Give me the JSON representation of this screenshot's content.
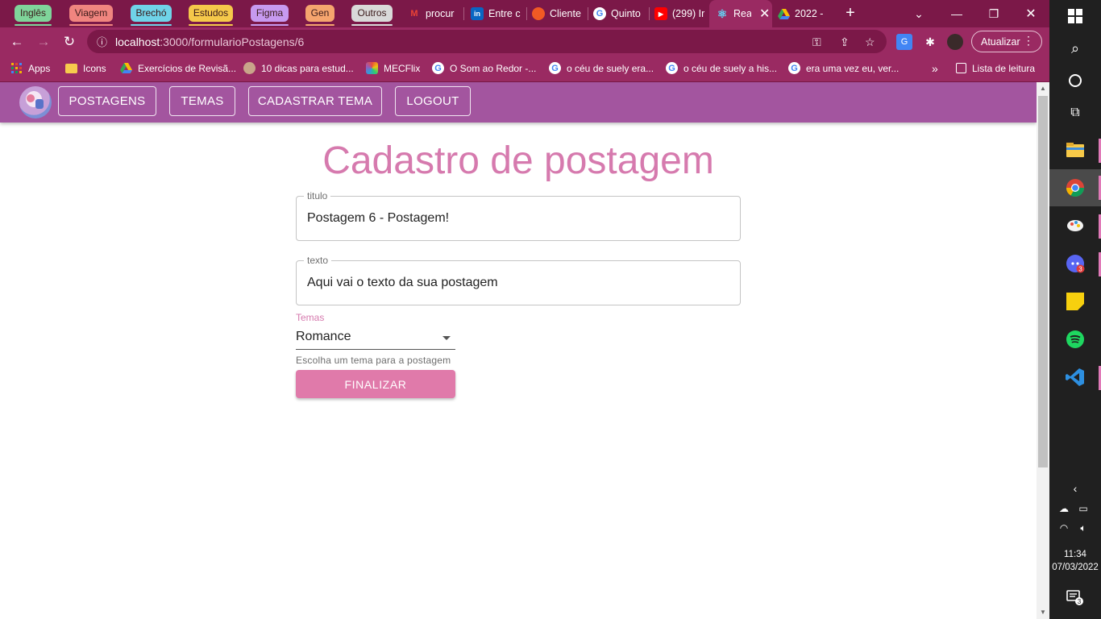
{
  "tab_groups": [
    {
      "label": "Inglês",
      "color": "#7fd49a"
    },
    {
      "label": "Viagem",
      "color": "#f0857f"
    },
    {
      "label": "Brechó",
      "color": "#6fd3e8"
    },
    {
      "label": "Estudos",
      "color": "#f5c84a"
    },
    {
      "label": "Figma",
      "color": "#c79af0"
    },
    {
      "label": "Gen",
      "color": "#f5a56e"
    },
    {
      "label": "Outros",
      "color": "#d9d9d9"
    }
  ],
  "tabs": [
    {
      "label": "procur",
      "icon": "gmail-icon"
    },
    {
      "label": "Entre c",
      "icon": "linkedin-icon"
    },
    {
      "label": "Cliente",
      "icon": "orange-app-icon"
    },
    {
      "label": "Quinto",
      "icon": "google-icon"
    },
    {
      "label": "(299) Ir",
      "icon": "youtube-icon"
    },
    {
      "label": "Rea",
      "icon": "react-icon",
      "active": true
    },
    {
      "label": "2022 -",
      "icon": "google-drive-icon"
    }
  ],
  "address_bar": {
    "host": "localhost",
    "path": ":3000/formularioPostagens/6"
  },
  "update_button": "Atualizar",
  "bookmarks": [
    {
      "label": "Apps",
      "icon": "apps-grid-icon"
    },
    {
      "label": "Icons",
      "icon": "folder-icon"
    },
    {
      "label": "Exercícios de Revisã...",
      "icon": "google-drive-icon"
    },
    {
      "label": "10 dicas para estud...",
      "icon": "avatar-icon"
    },
    {
      "label": "MECFlix",
      "icon": "mecflix-icon"
    },
    {
      "label": "O Som ao Redor -...",
      "icon": "google-icon"
    },
    {
      "label": "o céu de suely era...",
      "icon": "google-icon"
    },
    {
      "label": "o céu de suely a his...",
      "icon": "google-icon"
    },
    {
      "label": "era uma vez eu, ver...",
      "icon": "google-icon"
    }
  ],
  "reading_list": "Lista de leitura",
  "nav": {
    "postagens": "POSTAGENS",
    "temas": "TEMAS",
    "cadastrar_tema": "CADASTRAR TEMA",
    "logout": "LOGOUT"
  },
  "form": {
    "title": "Cadastro de postagem",
    "titulo_label": "titulo",
    "titulo_value": "Postagem 6 - Postagem!",
    "texto_label": "texto",
    "texto_value": "Aqui vai o texto da sua postagem",
    "temas_label": "Temas",
    "temas_value": "Romance",
    "temas_helper": "Escolha um tema para a postagem",
    "submit": "FINALIZAR"
  },
  "colors": {
    "chrome_dark": "#7b1848",
    "chrome_light": "#9a2a62",
    "appbar": "#a3559f",
    "accent_pink": "#d67aae",
    "button_pink": "#e07aaa"
  },
  "taskbar": {
    "time": "11:34",
    "date": "07/03/2022",
    "discord_badge": "3",
    "notification_badge": "3"
  }
}
